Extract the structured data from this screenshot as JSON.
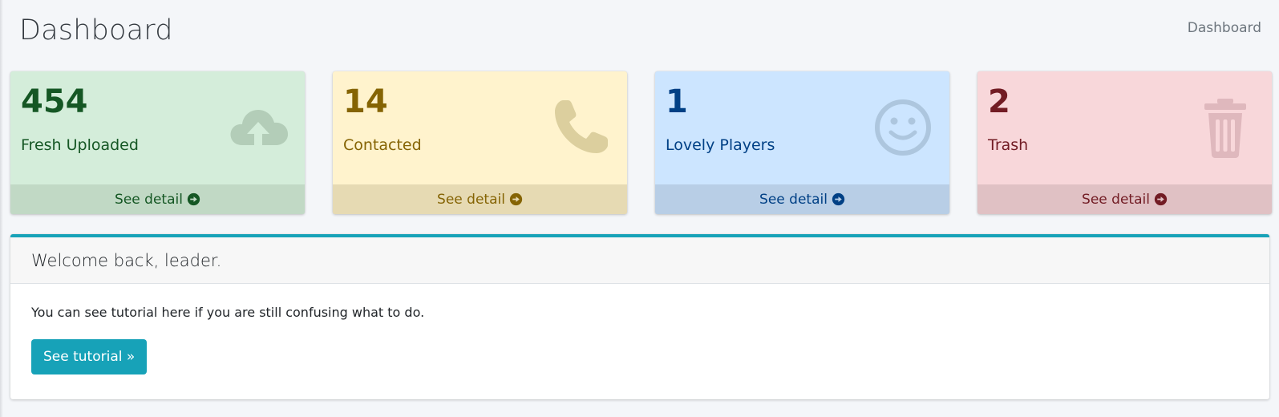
{
  "header": {
    "title": "Dashboard",
    "breadcrumb": "Dashboard"
  },
  "stats": [
    {
      "count": "454",
      "label": "Fresh Uploaded",
      "link": "See detail",
      "icon": "cloud-upload-icon",
      "color": "#155724"
    },
    {
      "count": "14",
      "label": "Contacted",
      "link": "See detail",
      "icon": "phone-icon",
      "color": "#856404"
    },
    {
      "count": "1",
      "label": "Lovely Players",
      "link": "See detail",
      "icon": "smile-icon",
      "color": "#004085"
    },
    {
      "count": "2",
      "label": "Trash",
      "link": "See detail",
      "icon": "trash-icon",
      "color": "#721c24"
    }
  ],
  "welcome": {
    "title": "Welcome back, leader.",
    "text": "You can see tutorial here if you are still confusing what to do.",
    "button_label": "See tutorial »",
    "accent": "#17a2b8"
  }
}
